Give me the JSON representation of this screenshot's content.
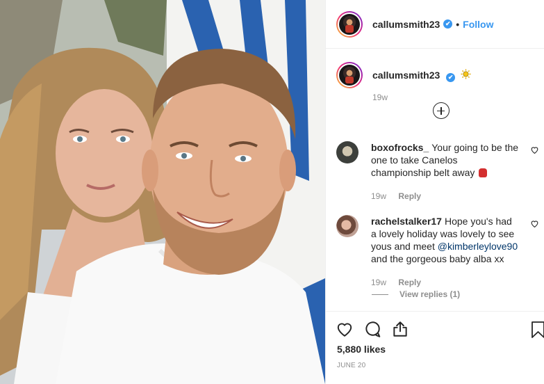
{
  "post": {
    "author": "callumsmith23",
    "verified_mark": "✔",
    "follow_label": "Follow",
    "separator": "•",
    "caption_time": "19w",
    "caption_emoji": "sun-emoji",
    "likes": "5,880 likes",
    "date": "JUNE 20"
  },
  "comments": [
    {
      "user": "boxofrocks_",
      "text": "Your going to be the one to take Canelos championship belt away",
      "emoji": "boxing-glove-emoji",
      "time": "19w",
      "reply_label": "Reply"
    },
    {
      "user": "rachelstalker17",
      "text_before": "Hope you's had a lovely holiday was lovely to see yous and meet",
      "mention": "@kimberleylove90",
      "text_after": "and the gorgeous baby alba xx",
      "time": "19w",
      "reply_label": "Reply",
      "view_replies": "View replies (1)"
    }
  ],
  "colors": {
    "link": "#3897f0",
    "text": "#262626",
    "muted": "#8e8e8e",
    "border": "#efefef"
  },
  "icons": [
    "heart-icon",
    "comment-icon",
    "share-icon",
    "bookmark-icon",
    "plus-circle-icon",
    "verified-badge-icon"
  ]
}
